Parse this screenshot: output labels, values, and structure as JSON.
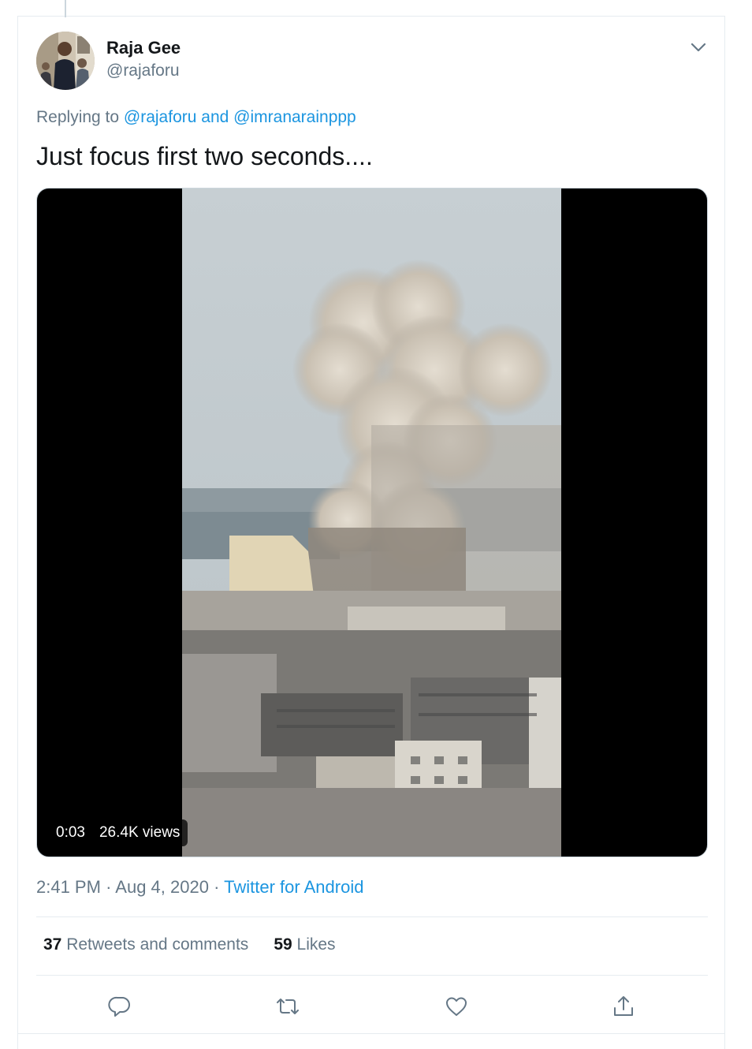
{
  "tweet": {
    "author_name": "Raja Gee",
    "author_handle": "@rajaforu",
    "replying_prefix": "Replying to",
    "reply_to_1": "@rajaforu",
    "reply_and": "and",
    "reply_to_2": "@imranarainppp",
    "text": "Just focus first two seconds....",
    "video": {
      "duration": "0:03",
      "views": "26.4K views"
    },
    "time": "2:41 PM",
    "separator": "·",
    "date": "Aug 4, 2020",
    "source": "Twitter for Android",
    "retweets_count": "37",
    "retweets_label": "Retweets and comments",
    "likes_count": "59",
    "likes_label": "Likes"
  },
  "icons": {
    "caret": "chevron-down-icon",
    "reply": "reply-icon",
    "retweet": "retweet-icon",
    "like": "heart-icon",
    "share": "share-icon"
  },
  "colors": {
    "link": "#1b95e0",
    "secondary_text": "#657786",
    "primary_text": "#14171a",
    "border": "#e6ecf0"
  }
}
